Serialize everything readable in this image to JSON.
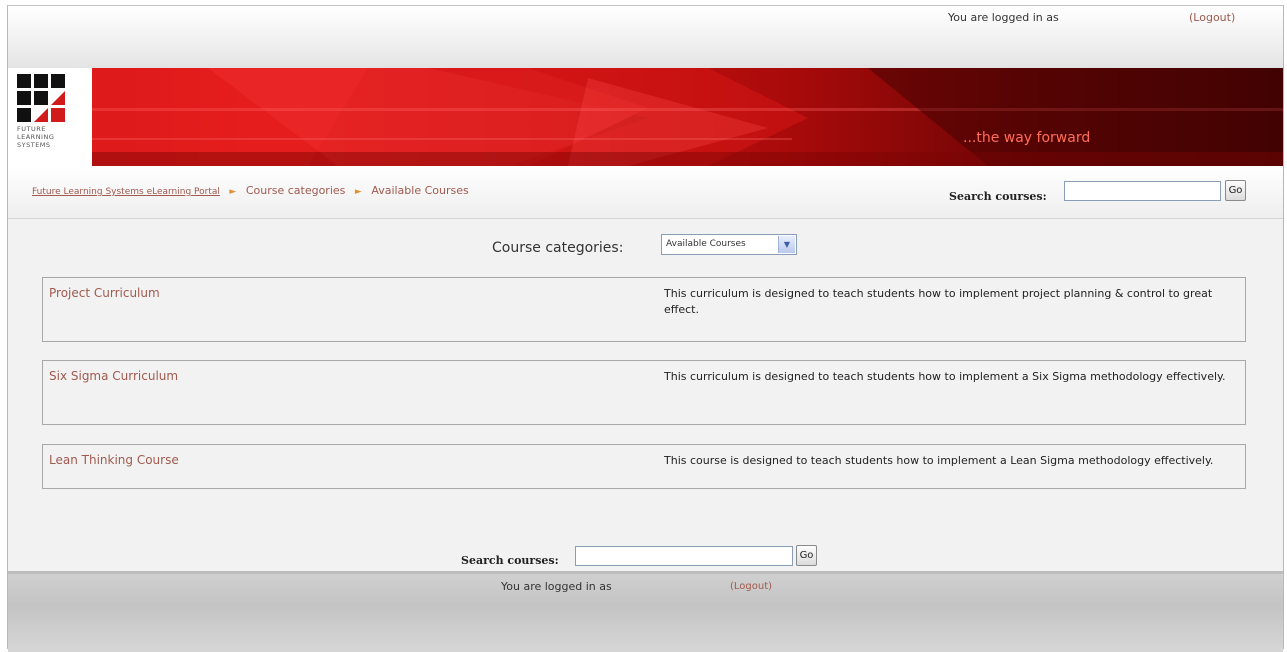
{
  "header": {
    "logged_in_text": "You are logged in as",
    "logout_label": "(Logout)"
  },
  "banner": {
    "logo_lines": [
      "FUTURE",
      "LEARNING",
      "SYSTEMS"
    ],
    "tagline": "...the way forward"
  },
  "breadcrumb": {
    "home": "Future Learning Systems eLearning Portal",
    "item1": "Course categories",
    "item2": "Available Courses",
    "separator": "►"
  },
  "search": {
    "label": "Search courses:",
    "go_label": "Go",
    "value": ""
  },
  "categories": {
    "label": "Course categories:",
    "selected": "Available Courses"
  },
  "courses": [
    {
      "name": "Project Curriculum",
      "description": "This curriculum is designed to teach students how to implement project planning & control to great effect."
    },
    {
      "name": "Six Sigma Curriculum",
      "description": "This curriculum is designed to teach students how to implement a Six Sigma methodology effectively."
    },
    {
      "name": "Lean Thinking Course",
      "description": "This course is designed to teach students how to implement a Lean Sigma methodology effectively."
    }
  ],
  "footer": {
    "logged_in_text": "You are logged in as",
    "logout_label": "(Logout)"
  },
  "colors": {
    "link": "#a05a4f",
    "banner_red": "#c20d0d",
    "separator_orange": "#e09030"
  }
}
